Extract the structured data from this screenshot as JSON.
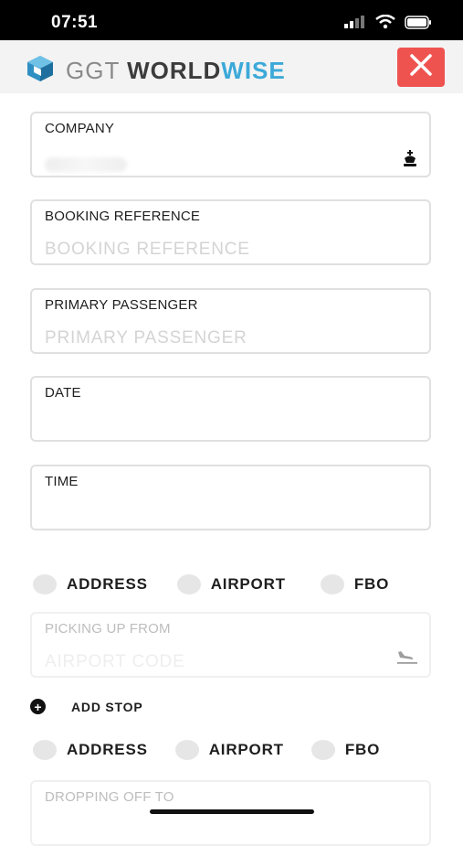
{
  "status": {
    "time": "07:51"
  },
  "header": {
    "logo_ggt": "GGT",
    "logo_world": "WORLD",
    "logo_wise": "WISE",
    "close_icon": "close-icon"
  },
  "form": {
    "company": {
      "label": "COMPANY",
      "value": "",
      "icon": "chess-king-icon"
    },
    "booking_reference": {
      "label": "BOOKING REFERENCE",
      "placeholder": "BOOKING REFERENCE"
    },
    "primary_passenger": {
      "label": "PRIMARY PASSENGER",
      "placeholder": "PRIMARY PASSENGER"
    },
    "date": {
      "label": "DATE",
      "value": ""
    },
    "time": {
      "label": "TIME",
      "value": ""
    },
    "pickup_options": [
      "ADDRESS",
      "AIRPORT",
      "FBO"
    ],
    "picking_up_from": {
      "label": "PICKING UP FROM",
      "placeholder": "AIRPORT CODE",
      "icon": "plane-landing-icon"
    },
    "add_stop": {
      "label": "ADD STOP",
      "icon": "plus-circle-icon"
    },
    "dropoff_options": [
      "ADDRESS",
      "AIRPORT",
      "FBO"
    ],
    "dropping_off_to": {
      "label": "DROPPING OFF TO"
    }
  },
  "colors": {
    "accent_red": "#ef5350",
    "logo_blue": "#3ca9d8"
  }
}
